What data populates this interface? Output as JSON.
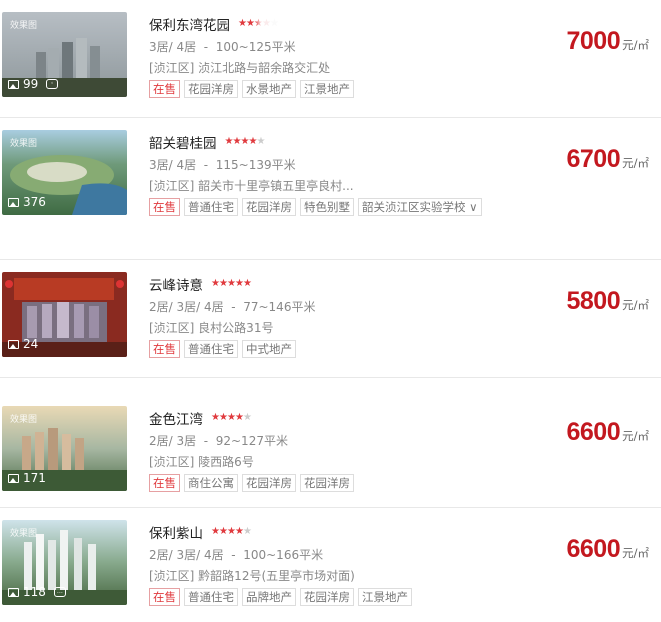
{
  "colors": {
    "price": "#c3181f",
    "sale_tag": "#e03a3e",
    "star_on": "#e03a3e",
    "star_off": "#cccccc"
  },
  "watermark": "效果图",
  "listings": [
    {
      "name": "保利东湾花园",
      "rating": 3.5,
      "layout": "3居/ 4居",
      "area": "100~125平米",
      "address": "[浈江区] 浈江北路与韶余路交汇处",
      "photo_count": "99",
      "extra_icon": "360-view-icon",
      "tags": [
        "在售",
        "花园洋房",
        "水景地产",
        "江景地产"
      ],
      "price": "7000",
      "price_unit": "元/㎡"
    },
    {
      "name": "韶关碧桂园",
      "rating": 3.5,
      "layout": "3居/ 4居",
      "area": "115~139平米",
      "address": "[浈江区] 韶关市十里亭镇五里亭良村...",
      "photo_count": "376",
      "tags": [
        "在售",
        "普通住宅",
        "花园洋房",
        "特色别墅",
        "韶关浈江区实验学校 ∨"
      ],
      "price": "6700",
      "price_unit": "元/㎡"
    },
    {
      "name": "云峰诗意",
      "rating": 4.5,
      "layout": "2居/ 3居/ 4居",
      "area": "77~146平米",
      "address": "[浈江区] 良村公路31号",
      "photo_count": "24",
      "tags": [
        "在售",
        "普通住宅",
        "中式地产"
      ],
      "price": "5800",
      "price_unit": "元/㎡"
    },
    {
      "name": "金色江湾",
      "rating": 3.5,
      "layout": "2居/ 3居",
      "area": "92~127平米",
      "address": "[浈江区] 陵西路6号",
      "photo_count": "171",
      "tags": [
        "在售",
        "商住公寓",
        "花园洋房",
        "花园洋房"
      ],
      "price": "6600",
      "price_unit": "元/㎡"
    },
    {
      "name": "保利紫山",
      "rating": 3.5,
      "layout": "2居/ 3居/ 4居",
      "area": "100~166平米",
      "address": "[浈江区] 黔韶路12号(五里亭市场对面)",
      "photo_count": "118",
      "extra_icon": "chat-icon",
      "tags": [
        "在售",
        "普通住宅",
        "品牌地产",
        "花园洋房",
        "江景地产"
      ],
      "price": "6600",
      "price_unit": "元/㎡"
    }
  ]
}
